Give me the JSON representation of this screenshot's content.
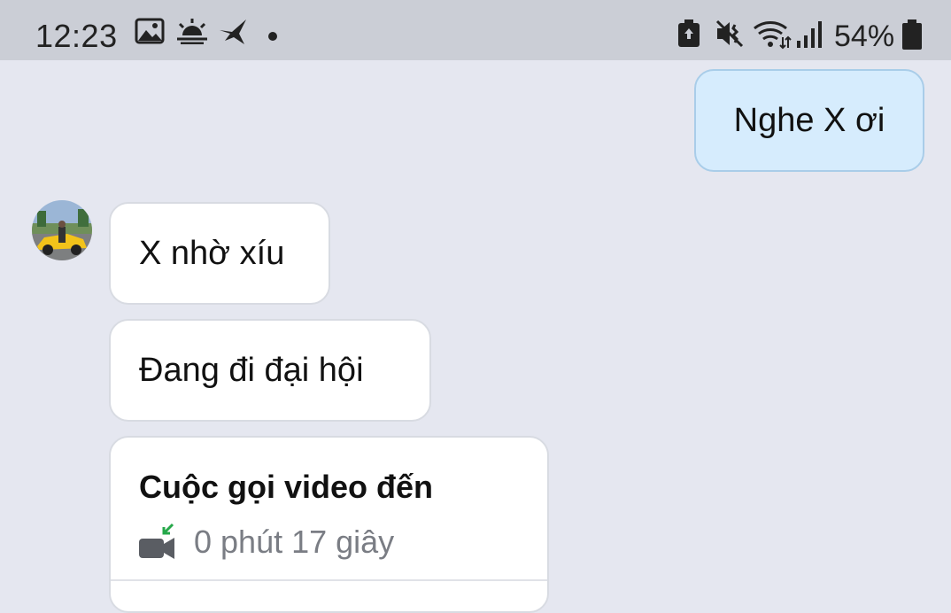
{
  "status_bar": {
    "time": "12:23",
    "battery": "54%",
    "icons": [
      "gallery-icon",
      "weather-icon",
      "bird-app-icon",
      "notification-dot-icon",
      "battery-saver-icon",
      "vibrate-icon",
      "wifi-icon",
      "signal-icon",
      "battery-icon"
    ]
  },
  "conversation": {
    "messages": [
      {
        "direction": "sent",
        "text": "Nghe X ơi"
      },
      {
        "direction": "received",
        "text": "X nhờ xíu"
      },
      {
        "direction": "received",
        "text": "Đang đi đại hội"
      }
    ],
    "call_card": {
      "title": "Cuộc gọi video đến",
      "duration": "0 phút 17 giây",
      "icon": "incoming-video-call-icon"
    },
    "colors": {
      "background": "#e5e7f0",
      "sent_bubble": "#d6ecfd",
      "received_bubble": "#ffffff"
    }
  }
}
